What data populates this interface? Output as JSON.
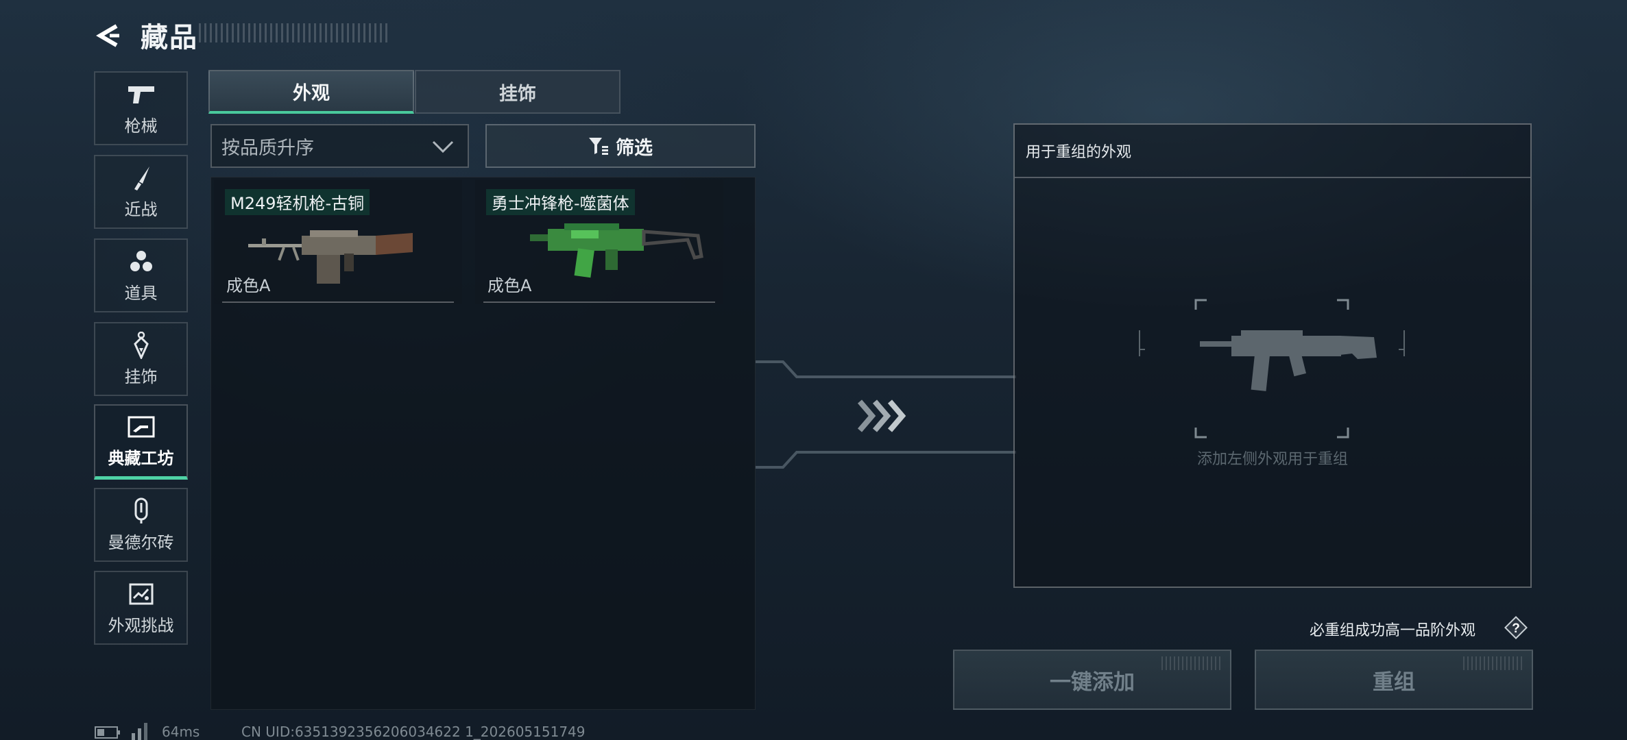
{
  "header": {
    "title": "藏品"
  },
  "sidebar": {
    "items": [
      {
        "label": "枪械",
        "icon": "pistol-icon"
      },
      {
        "label": "近战",
        "icon": "knife-icon"
      },
      {
        "label": "道具",
        "icon": "grenades-icon"
      },
      {
        "label": "挂饰",
        "icon": "charm-icon"
      },
      {
        "label": "典藏工坊",
        "icon": "workshop-icon",
        "active": true
      },
      {
        "label": "曼德尔砖",
        "icon": "brick-icon"
      },
      {
        "label": "外观挑战",
        "icon": "challenge-icon"
      }
    ]
  },
  "tabs": [
    {
      "label": "外观",
      "active": true
    },
    {
      "label": "挂饰",
      "active": false
    }
  ],
  "sort": {
    "value": "按品质升序"
  },
  "filter": {
    "label": "筛选"
  },
  "items": [
    {
      "name": "M249轻机枪-古铜",
      "grade": "成色A",
      "icon": "lmg-icon"
    },
    {
      "name": "勇士冲锋枪-噬菌体",
      "grade": "成色A",
      "icon": "smg-icon"
    }
  ],
  "recombine": {
    "title": "用于重组的外观",
    "hint": "添加左侧外观用于重组"
  },
  "guarantee": {
    "text": "必重组成功高一品阶外观",
    "help": "?"
  },
  "buttons": {
    "add_all": "一键添加",
    "recombine": "重组"
  },
  "status": {
    "ping": "64ms",
    "uid": "CN UID:6351392356206034622 1_202605151749"
  },
  "colors": {
    "accent": "#4ed2a5",
    "background": "#182532"
  }
}
